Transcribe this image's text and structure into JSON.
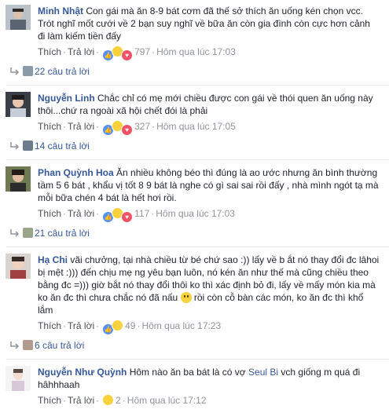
{
  "common": {
    "like": "Thích",
    "reply": "Trả lời",
    "dot": "·"
  },
  "comments": [
    {
      "name": "Minh Nhật",
      "text": "Con gái mà ăn 8-9 bát cơm đã thế sở thích ăn uống kén chọn vcc. Trót nghĩ mốt cưới về 2 bạn suy nghĩ về bữa ăn còn gia đình còn cực hơn cảnh đi làm kiếm tiền đấy",
      "reactions": [
        "like",
        "haha",
        "love"
      ],
      "count": "797",
      "time": "Hôm qua lúc 17:03",
      "replies": "22 câu trả lời"
    },
    {
      "name": "Nguyễn Linh",
      "text": "Chắc chỉ có mẹ mới chiều được con gái về thói quen ăn uống này thôi...chứ ra ngoài xã hội chết đói là phải",
      "reactions": [
        "like",
        "haha",
        "love"
      ],
      "count": "327",
      "time": "Hôm qua lúc 17:05",
      "replies": "14 câu trả lời"
    },
    {
      "name": "Phan Quỳnh Hoa",
      "text": "Ăn nhiều không béo thì đúng là ao ước nhưng ăn bình thường tầm 5 6 bát , khẩu vị tốt 8 9 bát là nghe có gì sai sai rồi đấy , nhà mình ngót tạ mà mỗi bữa chén 4 bát là hết hơi rồi.",
      "reactions": [
        "like",
        "haha",
        "love"
      ],
      "count": "117",
      "time": "Hôm qua lúc 17:03",
      "replies": "21 câu trả lời"
    },
    {
      "name": "Hạ Chi",
      "text_a": "vãi chưởng, tại nhà chiều từ bé chứ sao :)) lấy về b ắt nó thay đổi đc lâhoi bị mệt :))) đến chịu mẹ ng yêu bạn luôn, nó kén ăn như thế mà cũng chiều theo bằng đc =))) giờ bắt nó thay đổi thôi ko thì xác định bỏ đi, lấy về mấy món kia mà ko ăn đc thì chưa chắc nó đã nấu",
      "text_b": "rồi còn cỗ bàn các món, ko ăn đc thì khổ lắm",
      "emoji": "grinning-face",
      "reactions": [
        "like",
        "haha"
      ],
      "count": "49",
      "time": "Hôm qua lúc 17:23",
      "replies": "6 câu trả lời"
    },
    {
      "name": "Nguyễn Như Quỳnh",
      "text_a": "Hôm nào ăn ba bát là có vợ",
      "mention": "Seul Bi",
      "text_b": "vch giống m quá đi hâhhhaah",
      "reactions": [
        "haha"
      ],
      "count": "2",
      "time": "Hôm qua lúc 17:12"
    }
  ],
  "colors": {
    "link": "#365899",
    "meta": "#90949c",
    "text": "#1d2129"
  }
}
